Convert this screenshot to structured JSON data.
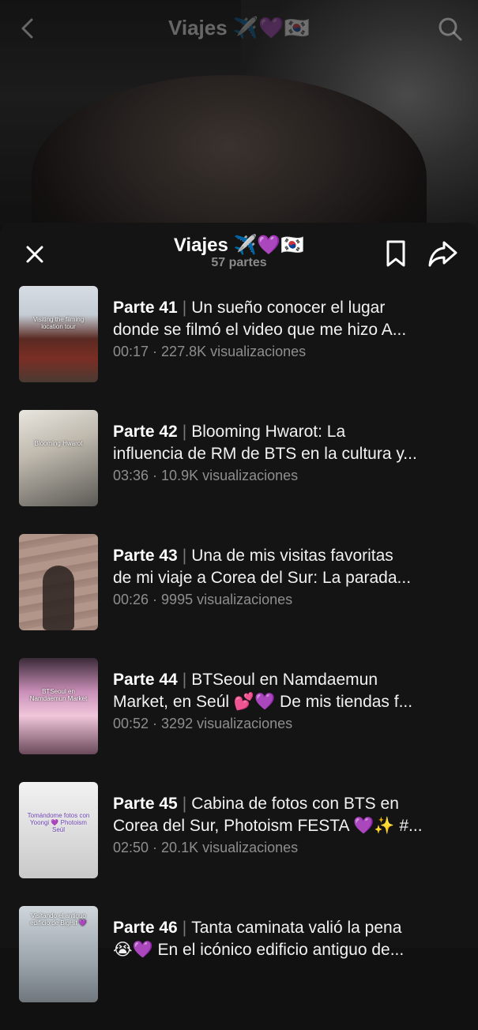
{
  "header": {
    "title": "Viajes ✈️💜🇰🇷"
  },
  "sheet": {
    "title": "Viajes ✈️💜🇰🇷",
    "subtitle": "57 partes"
  },
  "parts": [
    {
      "part": "Parte 41",
      "line1": "Un sueño conocer el lugar",
      "line2": "donde se filmó el video que me hizo A...",
      "duration": "00:17",
      "views": "227.8K visualizaciones",
      "thumb_caption": "Visiting the filming location tour"
    },
    {
      "part": "Parte 42",
      "line1": "Blooming Hwarot: La",
      "line2": "influencia de RM de BTS en la cultura y...",
      "duration": "03:36",
      "views": "10.9K visualizaciones",
      "thumb_caption": "Blooming Hwarot"
    },
    {
      "part": "Parte 43",
      "line1": "Una de mis visitas favoritas",
      "line2": "de mi viaje a Corea del Sur: La parada...",
      "duration": "00:26",
      "views": "9995 visualizaciones",
      "thumb_caption": ""
    },
    {
      "part": "Parte 44",
      "line1": "BTSeoul en Namdaemun",
      "line2": "Market, en Seúl 💕💜 De mis tiendas f...",
      "duration": "00:52",
      "views": "3292 visualizaciones",
      "thumb_caption": "BTSeoul en Namdaemun Market"
    },
    {
      "part": "Parte 45",
      "line1": "Cabina de fotos con BTS en",
      "line2": "Corea del Sur, Photoism FESTA 💜✨ #...",
      "duration": "02:50",
      "views": "20.1K visualizaciones",
      "thumb_caption": "Tomándome fotos con Yoongi 💜 Photoism Seúl"
    },
    {
      "part": "Parte 46",
      "line1": "Tanta caminata valió la pena",
      "line2": "😭💜 En el icónico edificio antiguo de...",
      "duration": "",
      "views": "",
      "thumb_caption": "Visitando el antiguo edificio de BigHit 💜"
    }
  ],
  "colors": {
    "background": "#141414",
    "text": "#ffffff",
    "meta": "#8e8e8e"
  },
  "icons": [
    "back-icon",
    "search-icon",
    "close-icon",
    "bookmark-icon",
    "share-icon"
  ]
}
